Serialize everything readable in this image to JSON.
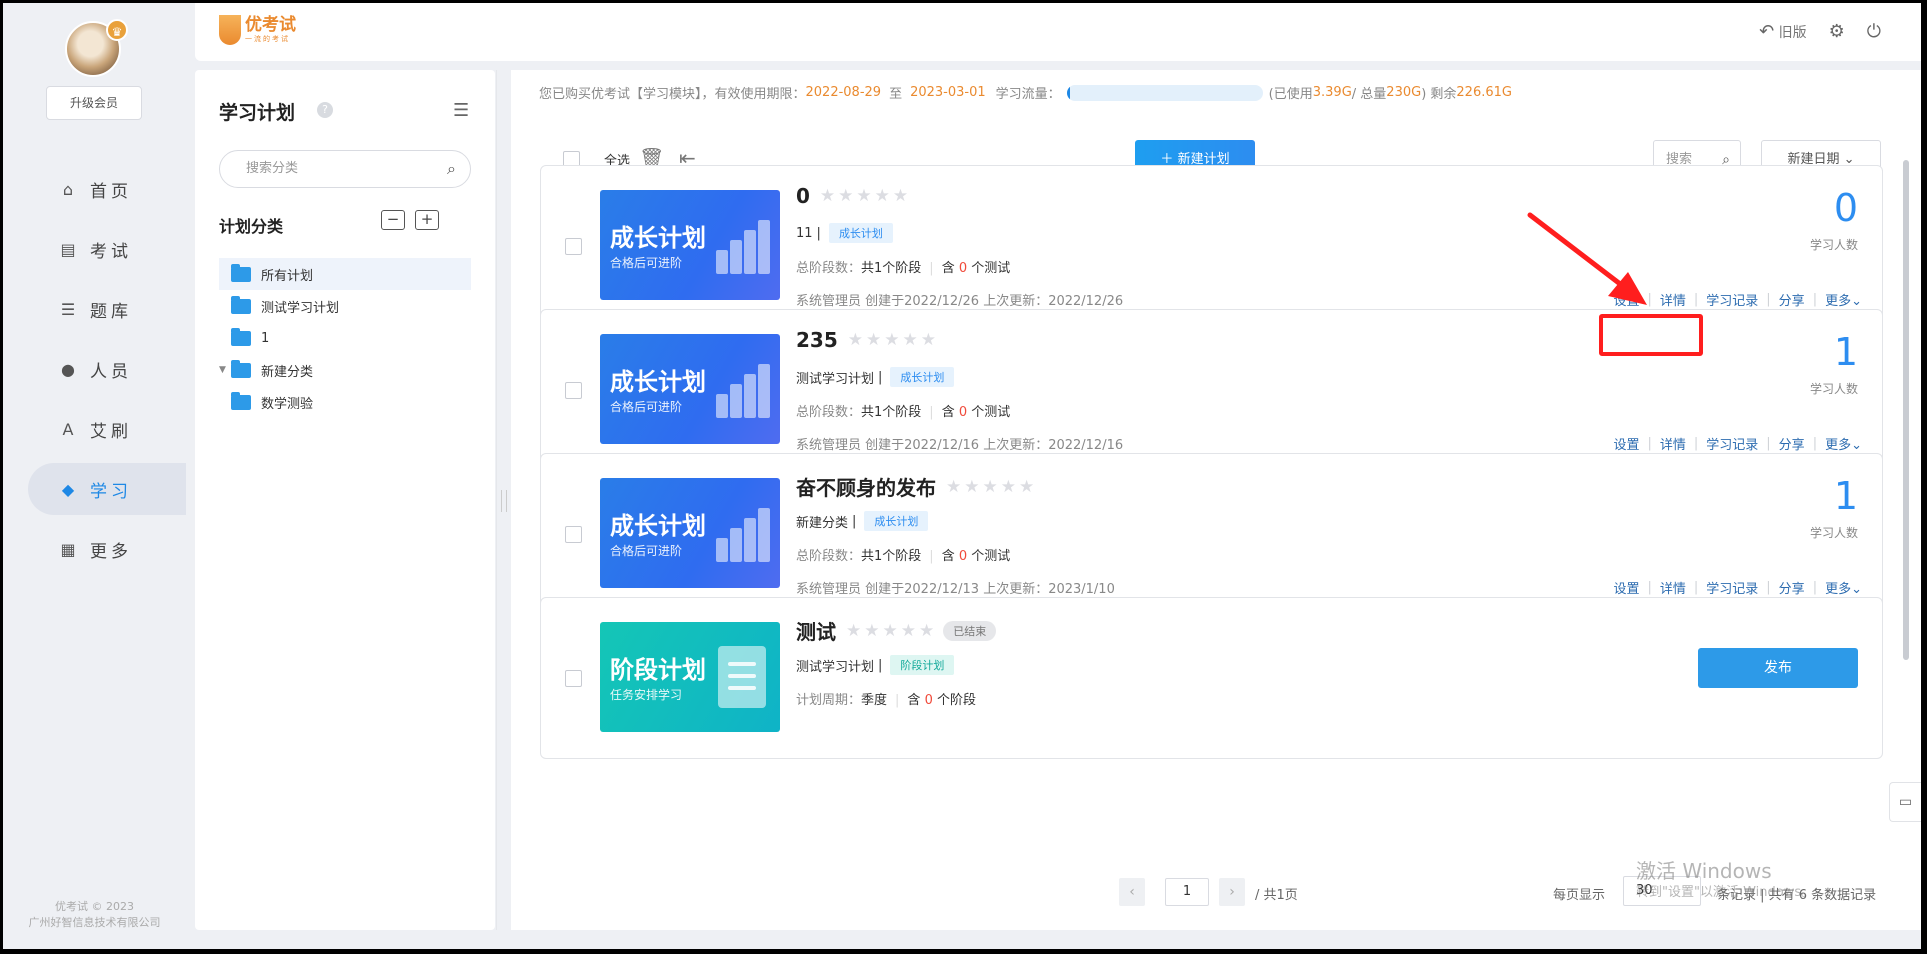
{
  "nav": {
    "upgrade_label": "升级会员",
    "items": [
      {
        "label": "首页",
        "icon": "home-icon",
        "glyph": "⌂"
      },
      {
        "label": "考试",
        "icon": "exam-icon",
        "glyph": "▤"
      },
      {
        "label": "题库",
        "icon": "question-bank-icon",
        "glyph": "☰"
      },
      {
        "label": "人员",
        "icon": "user-icon",
        "glyph": "●"
      },
      {
        "label": "艾刷",
        "icon": "brush-icon",
        "glyph": "A"
      },
      {
        "label": "学习",
        "icon": "study-icon",
        "glyph": "◆"
      },
      {
        "label": "更多",
        "icon": "more-grid-icon",
        "glyph": "▦"
      }
    ],
    "active": "学习",
    "footer_line1": "优考试 © 2023",
    "footer_line2": "广州好智信息技术有限公司"
  },
  "header": {
    "logo_text": "优考试",
    "logo_sub": "一流的考试",
    "old_version_label": "旧版"
  },
  "categories": {
    "title": "学习计划",
    "search_placeholder": "搜索分类",
    "section_title": "计划分类",
    "tree": [
      {
        "label": "所有计划",
        "selected": true,
        "expandable": false
      },
      {
        "label": "测试学习计划",
        "selected": false,
        "expandable": false
      },
      {
        "label": "1",
        "selected": false,
        "expandable": false
      },
      {
        "label": "新建分类",
        "selected": false,
        "expandable": true
      },
      {
        "label": "数学测验",
        "selected": false,
        "expandable": false
      }
    ]
  },
  "notice": {
    "prefix": "您已购买优考试【学习模块】，有效使用期限：",
    "start_date": "2022-08-29",
    "to": "至",
    "end_date": "2023-03-01",
    "flow_label": "学习流量：",
    "used_label": "(已使用",
    "used": "3.39G",
    "total_label": " / 总量",
    "total": "230G",
    "remain_label": ") 剩余",
    "remain": "226.61G",
    "used_fraction": 0.015
  },
  "toolbar": {
    "select_all": "全选",
    "new_plan": "新建计划",
    "search_placeholder": "搜索",
    "sort_label": "新建日期"
  },
  "plans": [
    {
      "title": "0",
      "thumb_title": "成长计划",
      "thumb_sub": "合格后可进阶",
      "thumb_kind": "growth",
      "category": "11",
      "tag": "成长计划",
      "line3_label": "总阶段数：",
      "line3_value": "共1个阶段",
      "line3_b_prefix": "含",
      "line3_b_num": "0",
      "line3_b_suffix": "个测试",
      "meta": "系统管理员 创建于2022/12/26  上次更新：2022/12/26",
      "count": "0",
      "count_label": "学习人数"
    },
    {
      "title": "235",
      "thumb_title": "成长计划",
      "thumb_sub": "合格后可进阶",
      "thumb_kind": "growth",
      "category": "测试学习计划",
      "tag": "成长计划",
      "line3_label": "总阶段数：",
      "line3_value": "共1个阶段",
      "line3_b_prefix": "含",
      "line3_b_num": "0",
      "line3_b_suffix": "个测试",
      "meta": "系统管理员 创建于2022/12/16  上次更新：2022/12/16",
      "count": "1",
      "count_label": "学习人数"
    },
    {
      "title": "奋不顾身的发布",
      "thumb_title": "成长计划",
      "thumb_sub": "合格后可进阶",
      "thumb_kind": "growth",
      "category": "新建分类",
      "tag": "成长计划",
      "line3_label": "总阶段数：",
      "line3_value": "共1个阶段",
      "line3_b_prefix": "含",
      "line3_b_num": "0",
      "line3_b_suffix": "个测试",
      "meta": "系统管理员 创建于2022/12/13  上次更新：2023/1/10",
      "count": "1",
      "count_label": "学习人数"
    },
    {
      "title": "测试",
      "badge": "已结束",
      "thumb_title": "阶段计划",
      "thumb_sub": "任务安排学习",
      "thumb_kind": "stage",
      "category": "测试学习计划",
      "tag": "阶段计划",
      "line3_label": "计划周期：",
      "line3_value": "季度",
      "line3_b_prefix": "含",
      "line3_b_num": "0",
      "line3_b_suffix": "个阶段",
      "publish_label": "发布"
    }
  ],
  "actions": {
    "settings": "设置",
    "details": "详情",
    "records": "学习记录",
    "share": "分享",
    "more": "更多"
  },
  "pager": {
    "current": "1",
    "total_pages": "/ 共1页",
    "per_page_label": "每页显示",
    "per_page": "30",
    "records": "条记录 | 共有 6 条数据记录"
  },
  "watermark": {
    "line1": "激活 Windows",
    "line2": "转到\"设置\"以激活 Windows。"
  },
  "colors": {
    "accent": "#2d8df0",
    "orange": "#ea8a2f",
    "red_annotation": "#ff1e1e"
  }
}
